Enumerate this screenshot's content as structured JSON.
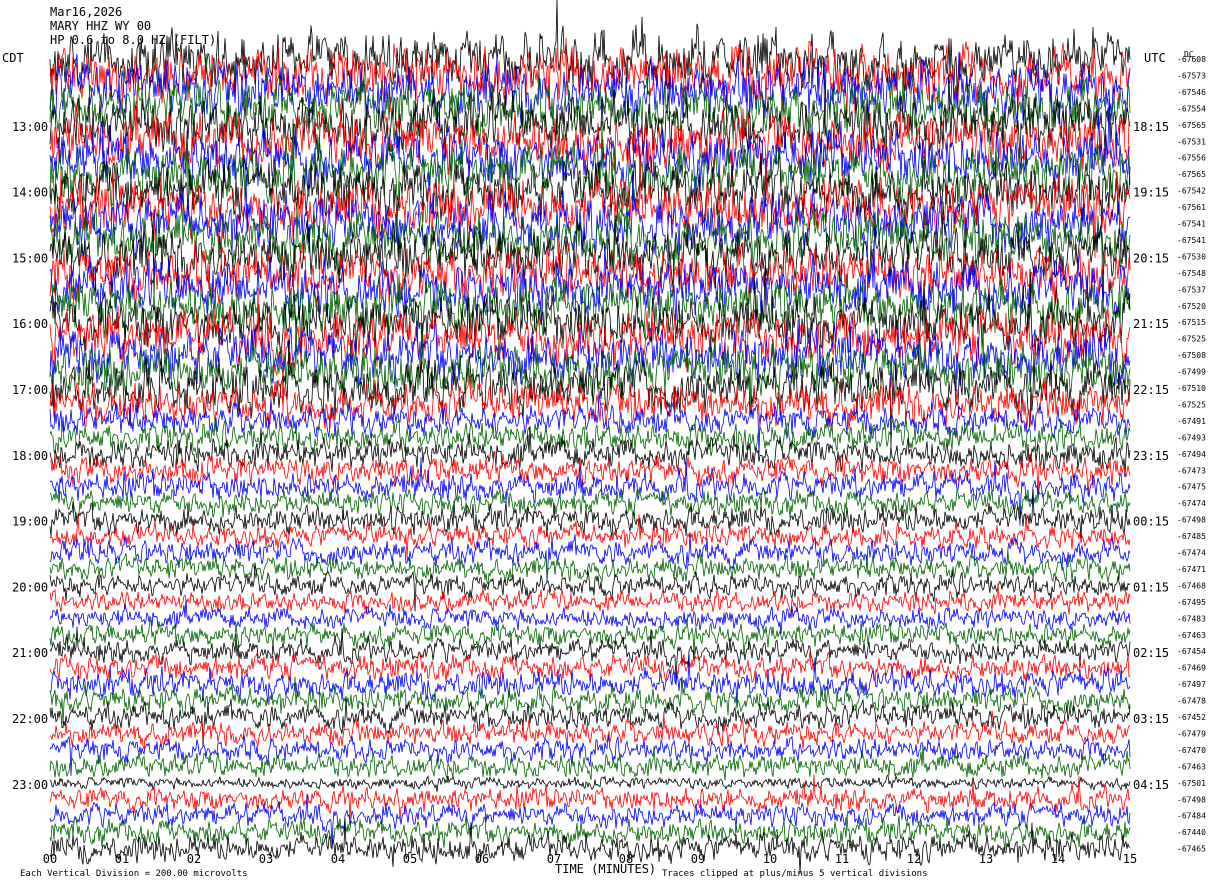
{
  "header": {
    "date": "Mar16,2026",
    "station": "MARY HHZ WY 00",
    "filter": "HP 0.6 to 8.0 HZ (FILT)"
  },
  "left_timezone": "CDT",
  "right_timezone": "UTC",
  "dc_label": "DC",
  "colors": [
    "#000000",
    "#ff0000",
    "#0000ff",
    "#006400"
  ],
  "chart_data": {
    "type": "line",
    "subtype": "helicorder",
    "xlabel": "TIME (MINUTES)",
    "x_ticks": [
      "00",
      "01",
      "02",
      "03",
      "04",
      "05",
      "06",
      "07",
      "08",
      "09",
      "10",
      "11",
      "12",
      "13",
      "14",
      "15"
    ],
    "xlim": [
      0,
      15
    ],
    "left_time_labels": [
      {
        "row": 4,
        "text": "13:00"
      },
      {
        "row": 8,
        "text": "14:00"
      },
      {
        "row": 12,
        "text": "15:00"
      },
      {
        "row": 16,
        "text": "16:00"
      },
      {
        "row": 20,
        "text": "17:00"
      },
      {
        "row": 24,
        "text": "18:00"
      },
      {
        "row": 28,
        "text": "19:00"
      },
      {
        "row": 32,
        "text": "20:00"
      },
      {
        "row": 36,
        "text": "21:00"
      },
      {
        "row": 40,
        "text": "22:00"
      },
      {
        "row": 44,
        "text": "23:00"
      }
    ],
    "right_time_labels": [
      {
        "row": 4,
        "text": "18:15"
      },
      {
        "row": 8,
        "text": "19:15"
      },
      {
        "row": 12,
        "text": "20:15"
      },
      {
        "row": 16,
        "text": "21:15"
      },
      {
        "row": 20,
        "text": "22:15"
      },
      {
        "row": 24,
        "text": "23:15"
      },
      {
        "row": 28,
        "text": "00:15"
      },
      {
        "row": 32,
        "text": "01:15"
      },
      {
        "row": 36,
        "text": "02:15"
      },
      {
        "row": 40,
        "text": "03:15"
      },
      {
        "row": 44,
        "text": "04:15"
      }
    ],
    "dc_offsets": [
      "-67608",
      "-67573",
      "-67546",
      "-67554",
      "-67565",
      "-67531",
      "-67556",
      "-67565",
      "-67542",
      "-67561",
      "-67541",
      "-67541",
      "-67530",
      "-67548",
      "-67537",
      "-67520",
      "-67515",
      "-67525",
      "-67508",
      "-67499",
      "-67510",
      "-67525",
      "-67491",
      "-67493",
      "-67494",
      "-67473",
      "-67475",
      "-67474",
      "-67498",
      "-67485",
      "-67474",
      "-67471",
      "-67468",
      "-67495",
      "-67483",
      "-67463",
      "-67454",
      "-67469",
      "-67497",
      "-67478",
      "-67452",
      "-67479",
      "-67470",
      "-67463",
      "-67501",
      "-67498",
      "-67484",
      "-67440",
      "-67465"
    ],
    "series": [
      {
        "name": "row color cycle",
        "colors": [
          "#000000",
          "#ff0000",
          "#0000ff",
          "#006400"
        ]
      }
    ],
    "row_amplitudes": [
      2.6,
      2.5,
      2.4,
      2.4,
      2.5,
      2.4,
      2.4,
      2.4,
      2.5,
      2.4,
      2.4,
      2.3,
      2.4,
      2.3,
      2.3,
      2.3,
      2.3,
      2.3,
      2.3,
      2.2,
      2.2,
      1.8,
      1.3,
      1.3,
      1.3,
      1.2,
      1.2,
      1.1,
      1.2,
      1.0,
      1.1,
      1.0,
      1.0,
      0.9,
      0.9,
      1.0,
      1.0,
      1.1,
      1.2,
      1.1,
      1.1,
      1.0,
      1.0,
      1.0,
      0.5,
      1.0,
      1.0,
      1.1,
      1.2
    ],
    "footer_left": "Each Vertical Division =  200.00 microvolts",
    "footer_right": "Traces clipped at plus/minus 5 vertical divisions"
  }
}
